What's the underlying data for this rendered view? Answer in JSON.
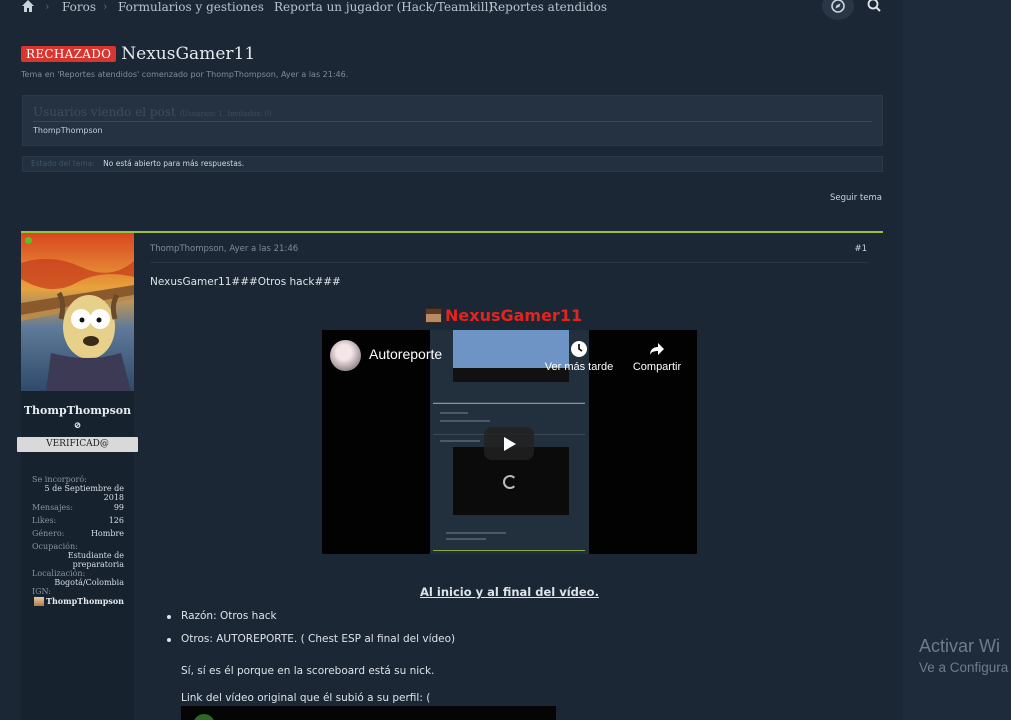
{
  "breadcrumb": {
    "items": [
      "Foros",
      "Formularios y gestiones",
      "Reporta un jugador (Hack/Teamkill)",
      "Reportes atendidos"
    ]
  },
  "thread": {
    "prefix": "RECHAZADO",
    "title": "NexusGamer11",
    "subline": "Tema en 'Reportes atendidos' comenzado por ThompThompson, Ayer a las 21:46.",
    "viewers_title": "Usuarios viendo el post",
    "viewers_counts": "(Usuarios: 1, Invitados: 0)",
    "viewers_user": "ThompThompson",
    "status_label": "Estado del tema:",
    "status_value": "No está abierto para más respuestas.",
    "follow_label": "Seguir tema"
  },
  "author": {
    "name": "ThompThompson",
    "rank": "VERIFICAD@",
    "stats": {
      "joined_label": "Se incorporó:",
      "joined_value": "5 de Septiembre de 2018",
      "messages_label": "Mensajes:",
      "messages_value": "99",
      "likes_label": "Likes:",
      "likes_value": "126",
      "gender_label": "Género:",
      "gender_value": "Hombre",
      "occupation_label": "Ocupación:",
      "occupation_value": "Estudiante de preparatoria",
      "location_label": "Localización:",
      "location_value": "Bogotá/Colombia",
      "ign_label": "IGN:",
      "ign_value": "ThompThompson"
    }
  },
  "post": {
    "meta": "ThompThompson, Ayer a las 21:46",
    "number": "#1",
    "first_line": "NexusGamer11###Otros hack###",
    "embed_title": "NexusGamer11",
    "video": {
      "title": "Autoreporte",
      "watch_later": "Ver más tarde",
      "share": "Compartir"
    },
    "caption": "Al inicio y al final del vídeo.",
    "bullets": [
      "Razón: Otros hack",
      "Otros: AUTOREPORTE. ( Chest ESP al final del vídeo)"
    ],
    "para1": "Sí, sí es él porque en la scoreboard está su nick.",
    "para2": "Link del vídeo original que él subió a su perfil: ("
  },
  "windows_overlay": {
    "line1": "Activar Wi",
    "line2": "Ve a Configura"
  }
}
